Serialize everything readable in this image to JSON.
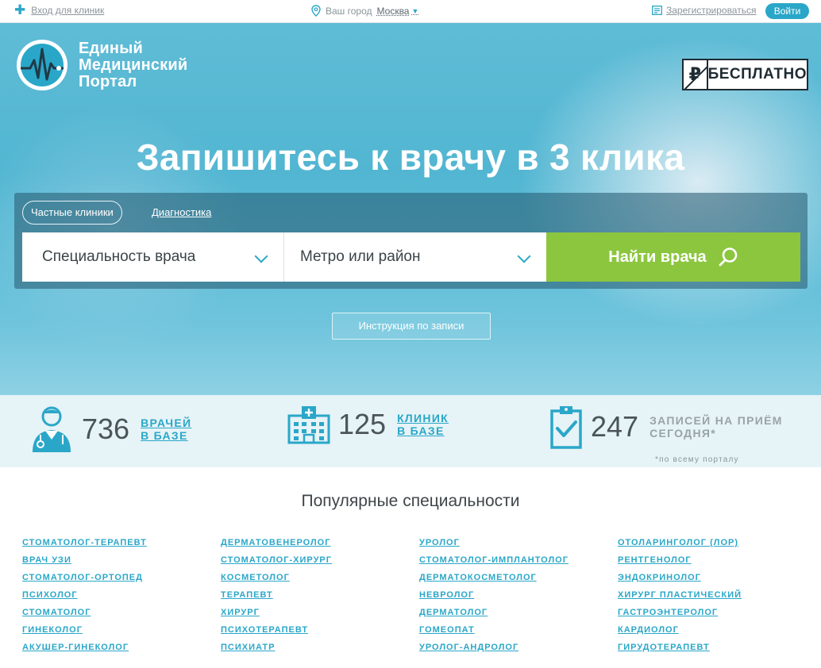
{
  "topbar": {
    "clinic_login": "Вход для клиник",
    "city_label": "Ваш город",
    "city_value": "Москва",
    "register": "Зарегистрироваться",
    "login": "Войти"
  },
  "hero": {
    "logo_line1": "Единый",
    "logo_line2": "Медицинский",
    "logo_line3": "Портал",
    "free_badge": "БЕСПЛАТНО",
    "free_symbol": "₽",
    "headline": "Запишитесь к врачу в 3 клика",
    "tab_private": "Частные клиники",
    "tab_diagnostics": "Диагностика",
    "specialty_placeholder": "Специальность врача",
    "metro_placeholder": "Метро или район",
    "find_button": "Найти врача",
    "instructions_button": "Инструкция по записи"
  },
  "stats": [
    {
      "value": "736",
      "label_line1": "врачей",
      "label_line2": "в базе",
      "icon": "doctor-icon",
      "style": "link"
    },
    {
      "value": "125",
      "label_line1": "клиник",
      "label_line2": "в базе",
      "icon": "hospital-icon",
      "style": "link"
    },
    {
      "value": "247",
      "label_line1": "записей на приём",
      "label_line2": "сегодня*",
      "icon": "clipboard-check-icon",
      "style": "gray"
    }
  ],
  "stats_note": "*по всему порталу",
  "popular": {
    "title": "Популярные специальности",
    "columns": [
      [
        "Стоматолог-терапевт",
        "Врач УЗИ",
        "Стоматолог-ортопед",
        "Психолог",
        "Стоматолог",
        "Гинеколог",
        "Акушер-гинеколог"
      ],
      [
        "Дерматовенеролог",
        "Стоматолог-хирург",
        "Косметолог",
        "Терапевт",
        "Хирург",
        "Психотерапевт",
        "Психиатр"
      ],
      [
        "Уролог",
        "Стоматолог-имплантолог",
        "Дерматокосметолог",
        "Невролог",
        "Дерматолог",
        "Гомеопат",
        "Уролог-андролог"
      ],
      [
        "Отоларинголог (ЛОР)",
        "Рентгенолог",
        "Эндокринолог",
        "Хирург пластический",
        "Гастроэнтеролог",
        "Кардиолог",
        "Гирудотерапевт"
      ]
    ]
  },
  "colors": {
    "accent": "#2aa7c8",
    "find_button": "#8cc63f",
    "stats_bg": "#e6f3f7"
  }
}
